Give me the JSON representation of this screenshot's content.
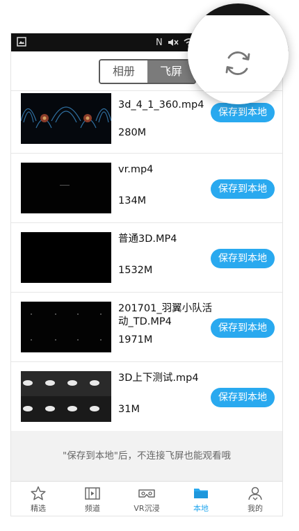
{
  "segmented": {
    "tab_album": "相册",
    "tab_flyscreen": "飞屏"
  },
  "videos": [
    {
      "title": "3d_4_1_360.mp4",
      "size": "280M",
      "save_label": "保存到本地"
    },
    {
      "title": "vr.mp4",
      "size": "134M",
      "save_label": "保存到本地"
    },
    {
      "title": "普通3D.MP4",
      "size": "1532M",
      "save_label": "保存到本地"
    },
    {
      "title": "201701_羽翼小队活动_TD.MP4",
      "size": "1971M",
      "save_label": "保存到本地"
    },
    {
      "title": "3D上下测试.mp4",
      "size": "31M",
      "save_label": "保存到本地"
    }
  ],
  "footer_note": "\"保存到本地\"后，不连接飞屏也能观看哦",
  "tabbar": {
    "items": [
      {
        "label": "精选",
        "icon": "star-icon"
      },
      {
        "label": "频道",
        "icon": "film-icon"
      },
      {
        "label": "VR沉浸",
        "icon": "vr-headset-icon"
      },
      {
        "label": "本地",
        "icon": "folder-icon"
      },
      {
        "label": "我的",
        "icon": "profile-icon"
      }
    ],
    "active_index": 3
  },
  "magnifier": {
    "icon": "refresh-icon"
  },
  "colors": {
    "accent": "#29a9ef",
    "segment_active": "#7b7b7b",
    "statusbar": "#111111"
  }
}
